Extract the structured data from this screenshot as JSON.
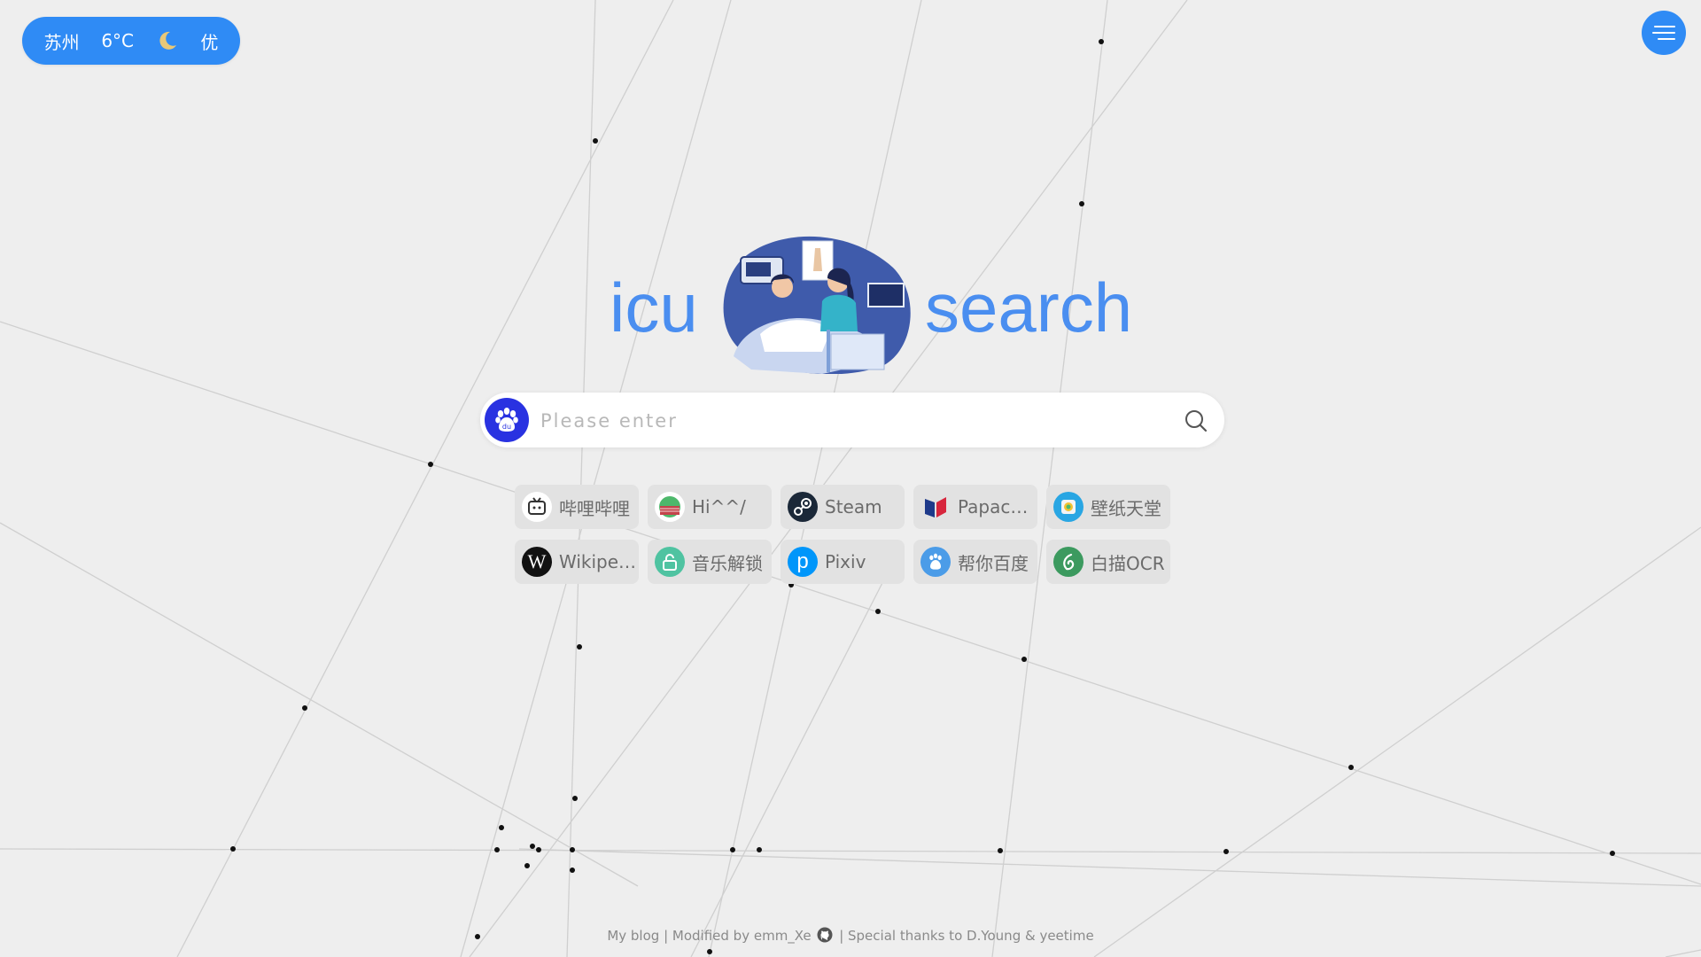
{
  "weather": {
    "city": "苏州",
    "temperature": "6°C",
    "icon": "moon-icon",
    "air_quality": "优"
  },
  "menu": {
    "icon": "menu-icon"
  },
  "logo": {
    "left_text": "icu",
    "right_text": "search",
    "illustration": "hospital-care-illustration"
  },
  "search": {
    "placeholder": "Please enter",
    "engine_icon": "baidu-paw-icon",
    "value": ""
  },
  "shortcuts": [
    {
      "label": "哔哩哔哩",
      "icon": "bilibili-tv-icon"
    },
    {
      "label": "Hi^^/",
      "icon": "globe-icon"
    },
    {
      "label": "Steam",
      "icon": "steam-icon"
    },
    {
      "label": "Papaca...",
      "icon": "papago-book-icon"
    },
    {
      "label": "壁纸天堂",
      "icon": "wallpaper-icon"
    },
    {
      "label": "Wikipedia",
      "icon": "wikipedia-icon"
    },
    {
      "label": "音乐解锁",
      "icon": "music-unlock-icon"
    },
    {
      "label": "Pixiv",
      "icon": "pixiv-icon"
    },
    {
      "label": "帮你百度",
      "icon": "baidu-paw-icon"
    },
    {
      "label": "白描OCR",
      "icon": "baimiao-ocr-icon"
    }
  ],
  "footer": {
    "blog": "My blog",
    "sep1": " | ",
    "modified": "Modified by emm_Xe",
    "github_icon": "github-icon",
    "sep2": " | ",
    "thanks": "Special thanks to D.Young & yeetime"
  },
  "colors": {
    "accent": "#2f8bf5",
    "logo_text": "#4a8ef0",
    "background": "#eeeeee",
    "baidu": "#2932e1"
  }
}
